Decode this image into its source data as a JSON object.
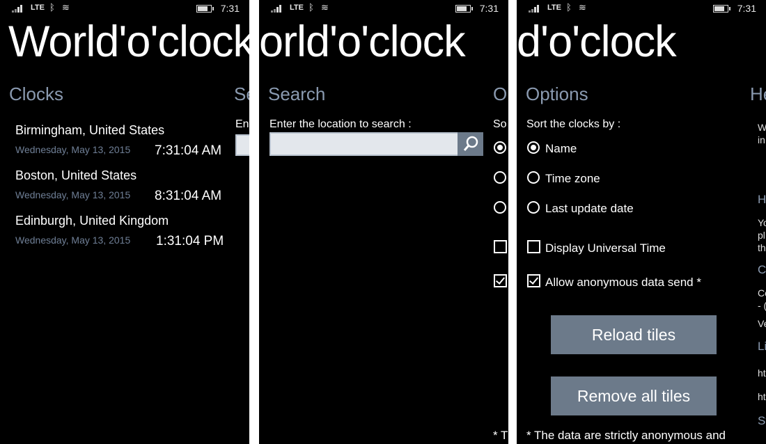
{
  "status": {
    "network": "LTE",
    "time": "7:31"
  },
  "app_title_1": "World'o'clock",
  "app_title_2": "orld'o'clock",
  "app_title_3": "d'o'clock",
  "panel1": {
    "header": "Clocks",
    "next_header": "Se",
    "next_label": "Ent",
    "clocks": [
      {
        "city": "Birmingham, United States",
        "date": "Wednesday, May 13, 2015",
        "time": "7:31:04 AM"
      },
      {
        "city": "Boston, United States",
        "date": "Wednesday, May 13, 2015",
        "time": "8:31:04 AM"
      },
      {
        "city": "Edinburgh, United Kingdom",
        "date": "Wednesday, May 13, 2015",
        "time": "1:31:04 PM"
      }
    ]
  },
  "panel2": {
    "header": "Search",
    "next_header": "Op",
    "label": "Enter the location to search :",
    "search_value": "",
    "next_label": "So",
    "next_footer": "* T"
  },
  "panel3": {
    "header": "Options",
    "next_header": "He",
    "sort_label": "Sort the clocks by :",
    "sort_options": [
      "Name",
      "Time zone",
      "Last update date"
    ],
    "selected_sort": "Name",
    "display_ut": "Display Universal Time",
    "display_ut_checked": false,
    "allow_data": "Allow anonymous data send *",
    "allow_data_checked": true,
    "reload_button": "Reload tiles",
    "remove_button": "Remove all tiles",
    "footnote": "* The data are strictly anonymous and",
    "peek": [
      "W",
      "in",
      "H",
      "Yo",
      "pl",
      "th",
      "C",
      "Co",
      "- (",
      "Ve",
      "Li",
      "ht",
      "ht",
      "St"
    ]
  }
}
